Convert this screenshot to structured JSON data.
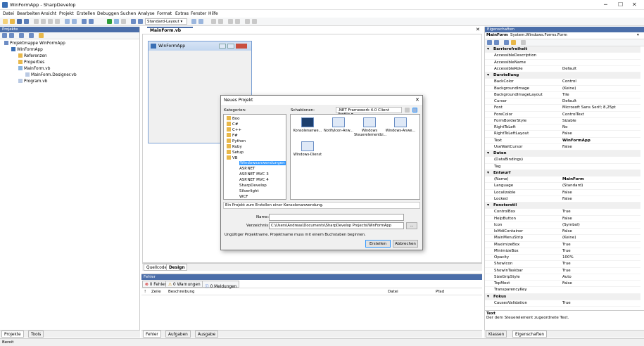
{
  "window": {
    "title": "WinFormApp - SharpDevelop"
  },
  "menu": [
    "Datei",
    "Bearbeiten",
    "Ansicht",
    "Projekt",
    "Erstellen",
    "Debuggen",
    "Suchen",
    "Analyse",
    "Format",
    "Extras",
    "Fenster",
    "Hilfe"
  ],
  "toolbar": {
    "layout_combo": "Standard-Layout"
  },
  "projects": {
    "title": "Projekte",
    "tree": [
      "Projektmappe WinFormApp",
      "WinFormApp",
      "Referenzen",
      "Properties",
      "MainForm.vb",
      "MainForm.Designer.vb",
      "Program.vb"
    ]
  },
  "editor": {
    "tab": "MainForm.vb",
    "form_title": "WinFormApp",
    "bottom_tabs": [
      "Quellcode",
      "Design"
    ]
  },
  "errors_panel": {
    "title": "Fehler",
    "buttons": [
      "0 Fehler",
      "0 Warnungen",
      "0 Meldungen"
    ],
    "columns": [
      "!",
      "Zeile",
      "Beschreibung",
      "Datei",
      "Pfad"
    ]
  },
  "left_bottom_tabs": [
    "Projekte",
    "Tools"
  ],
  "center_bottom_tabs": [
    "Fehler",
    "Aufgaben",
    "Ausgabe"
  ],
  "properties": {
    "title": "Eigenschaften",
    "object": "MainForm",
    "object_type": "System.Windows.Forms.Form",
    "rows": [
      {
        "cat": true,
        "name": "Barrierefreiheit"
      },
      {
        "name": "AccessibleDescription",
        "value": ""
      },
      {
        "name": "AccessibleName",
        "value": ""
      },
      {
        "name": "AccessibleRole",
        "value": "Default"
      },
      {
        "cat": true,
        "name": "Darstellung"
      },
      {
        "name": "BackColor",
        "value": "Control"
      },
      {
        "name": "BackgroundImage",
        "value": "(Keine)"
      },
      {
        "name": "BackgroundImageLayout",
        "value": "Tile"
      },
      {
        "name": "Cursor",
        "value": "Default"
      },
      {
        "name": "Font",
        "value": "Microsoft Sans Serif; 8,25pt"
      },
      {
        "name": "ForeColor",
        "value": "ControlText"
      },
      {
        "name": "FormBorderStyle",
        "value": "Sizable"
      },
      {
        "name": "RightToLeft",
        "value": "No"
      },
      {
        "name": "RightToLeftLayout",
        "value": "False"
      },
      {
        "name": "Text",
        "value": "WinFormApp",
        "bold": true
      },
      {
        "name": "UseWaitCursor",
        "value": "False"
      },
      {
        "cat": true,
        "name": "Daten"
      },
      {
        "name": "(DataBindings)",
        "value": ""
      },
      {
        "name": "Tag",
        "value": ""
      },
      {
        "cat": true,
        "name": "Entwurf"
      },
      {
        "name": "(Name)",
        "value": "MainForm",
        "bold": true
      },
      {
        "name": "Language",
        "value": "(Standard)"
      },
      {
        "name": "Localizable",
        "value": "False"
      },
      {
        "name": "Locked",
        "value": "False"
      },
      {
        "cat": true,
        "name": "Fensterstil"
      },
      {
        "name": "ControlBox",
        "value": "True"
      },
      {
        "name": "HelpButton",
        "value": "False"
      },
      {
        "name": "Icon",
        "value": "(Symbol)"
      },
      {
        "name": "IsMdiContainer",
        "value": "False"
      },
      {
        "name": "MainMenuStrip",
        "value": "(Keine)"
      },
      {
        "name": "MaximizeBox",
        "value": "True"
      },
      {
        "name": "MinimizeBox",
        "value": "True"
      },
      {
        "name": "Opacity",
        "value": "100%"
      },
      {
        "name": "ShowIcon",
        "value": "True"
      },
      {
        "name": "ShowInTaskbar",
        "value": "True"
      },
      {
        "name": "SizeGripStyle",
        "value": "Auto"
      },
      {
        "name": "TopMost",
        "value": "False"
      },
      {
        "name": "TransparencyKey",
        "value": ""
      },
      {
        "cat": true,
        "name": "Fokus"
      },
      {
        "name": "CausesValidation",
        "value": "True"
      }
    ],
    "help_title": "Text",
    "help_text": "Der dem Steuerelement zugeordnete Text.",
    "bottom_tabs": [
      "Klassen",
      "Eigenschaften"
    ]
  },
  "dialog": {
    "title": "Neues Projekt",
    "categories_label": "Kategorien:",
    "templates_label": "Schablonen:",
    "framework": ".NET Framework 4.0 Client Profile",
    "categories": [
      "Boo",
      "C#",
      "C++",
      "F#",
      "Python",
      "Ruby",
      "Setup",
      "VB",
      "Windowsanwendungen",
      "ASP.NET",
      "ASP.NET MVC 3",
      "ASP.NET MVC 4",
      "SharpDevelop",
      "Silverlight",
      "WCF"
    ],
    "templates": [
      "Konsolenanwe...",
      "NotifyIcon-Anw...",
      "Windows Steuerelementbi...",
      "Windows-Anwe...",
      "Windows-Dienst"
    ],
    "description": "Ein Projekt zum Erstellen einer Konsolenanwendung.",
    "name_label": "Name:",
    "name_value": "",
    "dir_label": "Verzeichnis:",
    "dir_value": "C:\\Users\\Andreas\\Documents\\SharpDevelop Projects\\WinFormApp",
    "browse": "...",
    "error": "Ungültiger Projektname. Projektname muss mit einem Buchstaben beginnen.",
    "ok": "Erstellen",
    "cancel": "Abbrechen"
  },
  "status": "Bereit",
  "colors": {
    "panel_header": "#4b6ea9",
    "accent": "#3399ff"
  }
}
